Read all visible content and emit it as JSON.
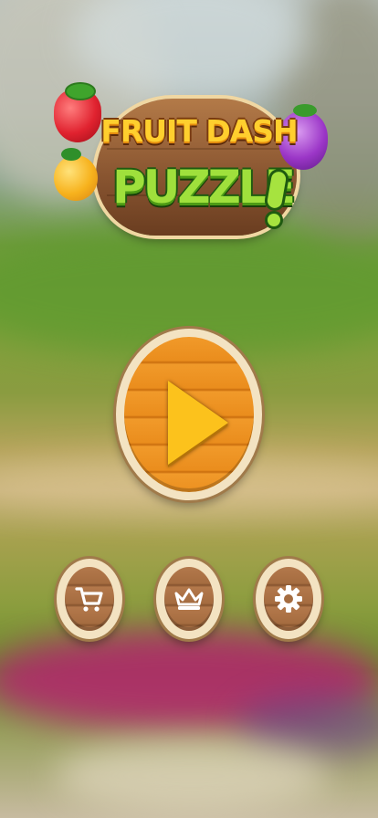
{
  "title": {
    "line1": "FRUIT DASH",
    "line2": "PUZZLE"
  },
  "buttons": {
    "play": {
      "icon": "play-icon"
    },
    "shop": {
      "icon": "cart-icon"
    },
    "leaderboard": {
      "icon": "crown-icon"
    },
    "settings": {
      "icon": "gear-icon"
    }
  },
  "colors": {
    "play_wood": "#ea8e21",
    "small_wood": "#a56c40",
    "play_arrow": "#fcc21c",
    "title_yellow": "#ffcf2e",
    "title_green": "#9fe03c"
  }
}
